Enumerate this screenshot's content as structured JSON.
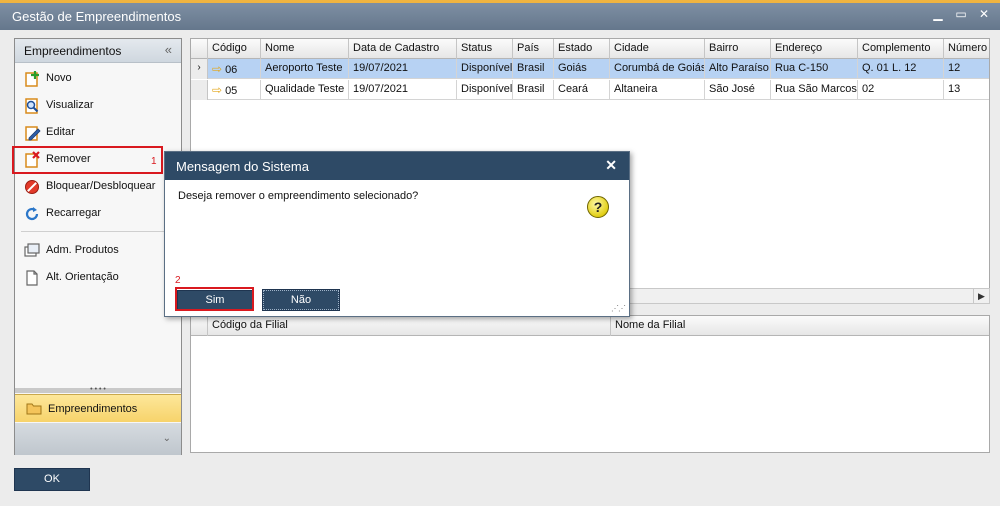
{
  "window": {
    "title": "Gestão de Empreendimentos",
    "minimize": "▁",
    "maximize": "▭",
    "close": "✕"
  },
  "sidebar": {
    "header": "Empreendimentos",
    "collapse": "«",
    "items": [
      {
        "label": "Novo",
        "icon": "add-document-icon"
      },
      {
        "label": "Visualizar",
        "icon": "magnify-document-icon"
      },
      {
        "label": "Editar",
        "icon": "edit-pencil-icon"
      },
      {
        "label": "Remover",
        "icon": "remove-document-icon",
        "step": "1"
      },
      {
        "label": "Bloquear/Desbloquear",
        "icon": "block-icon"
      },
      {
        "label": "Recarregar",
        "icon": "refresh-icon"
      },
      {
        "label": "Adm. Produtos",
        "icon": "windows-icon"
      },
      {
        "label": "Alt. Orientação",
        "icon": "document-icon"
      }
    ],
    "tab": "Empreendimentos",
    "foot_chevron": "⌄"
  },
  "grid": {
    "columns": [
      "Código",
      "Nome",
      "Data de Cadastro",
      "Status",
      "País",
      "Estado",
      "Cidade",
      "Bairro",
      "Endereço",
      "Complemento",
      "Número"
    ],
    "rows": [
      {
        "selected": true,
        "indicator": "›",
        "cells": [
          "06",
          "Aeroporto Teste",
          "19/07/2021",
          "Disponível",
          "Brasil",
          "Goiás",
          "Corumbá de Goiás",
          "Alto Paraíso",
          "Rua C-150",
          "Q. 01 L. 12",
          "12"
        ]
      },
      {
        "selected": false,
        "indicator": "",
        "cells": [
          "05",
          "Qualidade Teste",
          "19/07/2021",
          "Disponível",
          "Brasil",
          "Ceará",
          "Altaneira",
          "São José",
          "Rua São Marcos",
          "02",
          "13"
        ]
      }
    ]
  },
  "grid2": {
    "columns": [
      "Código da Filial",
      "Nome da Filial"
    ]
  },
  "footer": {
    "ok_label": "OK"
  },
  "dialog": {
    "title": "Mensagem do Sistema",
    "close": "✕",
    "message": "Deseja remover o empreendimento selecionado?",
    "question_mark": "?",
    "yes_label": "Sim",
    "no_label": "Não",
    "step": "2"
  },
  "colors": {
    "accent": "#2e4a66",
    "highlight": "#d9191f",
    "selection": "#b7d2f3",
    "tab": "#f7d36b"
  }
}
